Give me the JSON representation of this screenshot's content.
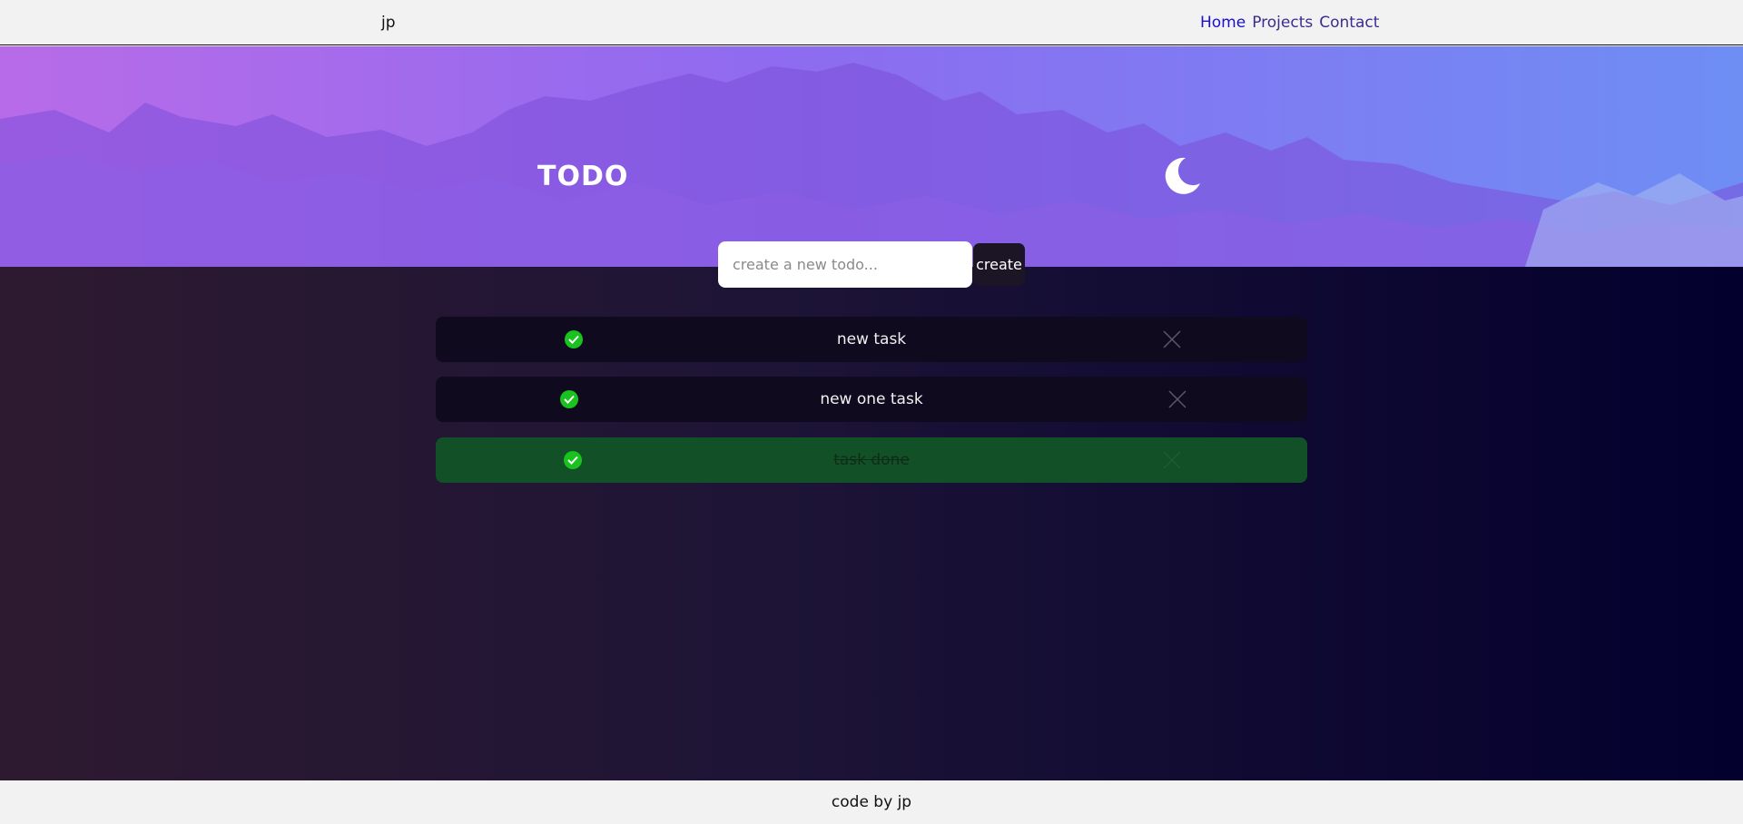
{
  "nav": {
    "brand": "jp",
    "links": [
      {
        "label": "Home",
        "active": true
      },
      {
        "label": "Projects",
        "active": false
      },
      {
        "label": "Contact",
        "active": false
      }
    ]
  },
  "header": {
    "title": "TODO",
    "theme_toggle_icon": "moon-icon"
  },
  "create": {
    "placeholder": "create a new todo...",
    "value": "",
    "button_label": "create"
  },
  "todos": [
    {
      "text": "new task",
      "completed": false
    },
    {
      "text": "new one task",
      "completed": false
    },
    {
      "text": "task done",
      "completed": true
    }
  ],
  "footer": {
    "text": "code by jp"
  },
  "colors": {
    "accent_check": "#19c21e",
    "done_row": "#125128",
    "row": "#0f0a1d",
    "nav_active_link": "#1a10c9"
  }
}
